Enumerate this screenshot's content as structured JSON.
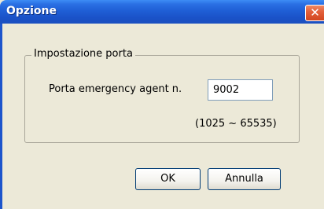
{
  "window": {
    "title": "Opzione",
    "close_glyph": "✕"
  },
  "group": {
    "title": "Impostazione porta"
  },
  "port": {
    "label": "Porta emergency agent n.",
    "value": "9002",
    "range": "(1025 ~ 65535)"
  },
  "buttons": {
    "ok": "OK",
    "cancel": "Annulla"
  },
  "colors": {
    "titlebar": "#1f5fd6",
    "close": "#d2461f",
    "dialog_bg": "#ece9d8"
  },
  "icons": [
    "close-icon"
  ]
}
